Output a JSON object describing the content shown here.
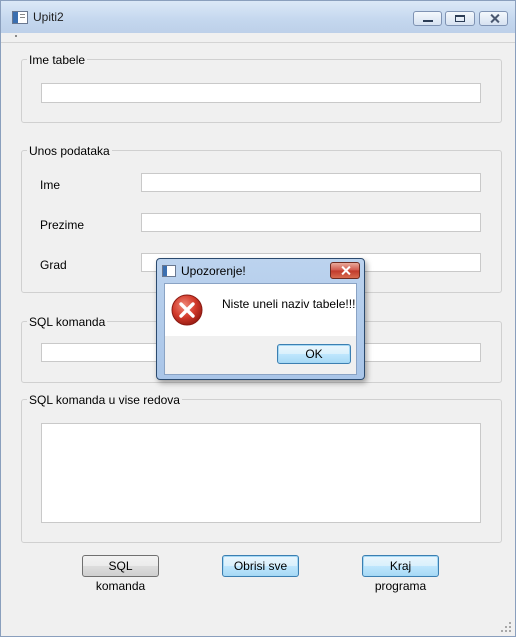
{
  "window": {
    "title": "Upiti2",
    "icon": "app-window-icon"
  },
  "groups": {
    "table_name": {
      "title": "Ime tabele",
      "value": ""
    },
    "data_entry": {
      "title": "Unos podataka",
      "fields": [
        {
          "label": "Ime",
          "value": ""
        },
        {
          "label": "Prezime",
          "value": ""
        },
        {
          "label": "Grad",
          "value": ""
        }
      ]
    },
    "sql_command": {
      "title": "SQL komanda",
      "value": ""
    },
    "sql_multiline": {
      "title": "SQL komanda u vise redova",
      "value": ""
    }
  },
  "buttons": {
    "sql": "SQL komanda",
    "clear": "Obrisi sve",
    "exit": "Kraj programa"
  },
  "dialog": {
    "title": "Upozorenje!",
    "message": "Niste uneli naziv tabele!!!",
    "ok": "OK",
    "icon": "error-icon"
  },
  "colors": {
    "error_red": "#c0392b",
    "focus_blue": "#3c7fb1"
  }
}
